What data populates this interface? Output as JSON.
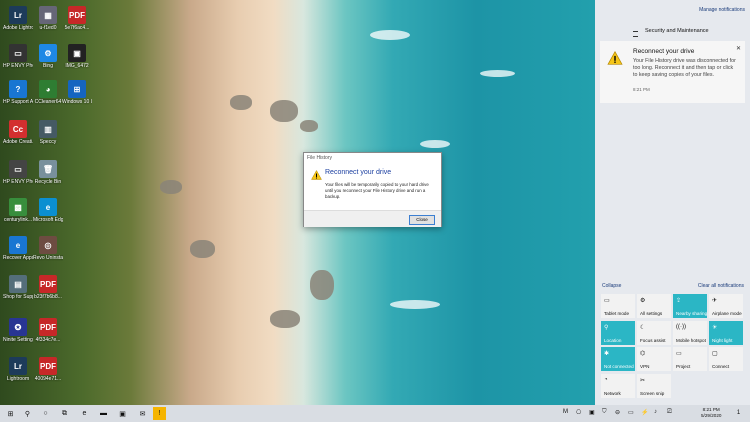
{
  "desktop_icons": [
    {
      "label": "Adobe Lightroom",
      "glyph": "Lr",
      "color": "#1d3b5a"
    },
    {
      "label": "u-f1ed0",
      "glyph": "▦",
      "color": "#667"
    },
    {
      "label": "5e7f6ac4...",
      "glyph": "PDF",
      "color": "#c62828"
    },
    {
      "label": "HP ENVY Photo 7...",
      "glyph": "▭",
      "color": "#333"
    },
    {
      "label": "Bing",
      "glyph": "⚙",
      "color": "#1e88e5"
    },
    {
      "label": "IMG_6472",
      "glyph": "▣",
      "color": "#222"
    },
    {
      "label": "HP Support Assistant",
      "glyph": "?",
      "color": "#1976d2"
    },
    {
      "label": "CCleaner64",
      "glyph": "◕",
      "color": "#2e7d32"
    },
    {
      "label": "Windows 10 Update A...",
      "glyph": "⊞",
      "color": "#1565c0"
    },
    {
      "label": "Adobe Creati...",
      "glyph": "Cc",
      "color": "#d32f2f"
    },
    {
      "label": "Speccy",
      "glyph": "▥",
      "color": "#455a64"
    },
    {
      "label": "HP ENVY Photo 71...",
      "glyph": "▭",
      "color": "#444"
    },
    {
      "label": "Recycle Bin",
      "glyph": "🗑",
      "color": "#78909c"
    },
    {
      "label": "centurylink...",
      "glyph": "▩",
      "color": "#388e3c"
    },
    {
      "label": "Microsoft Edge",
      "glyph": "e",
      "color": "#0b8fd1"
    },
    {
      "label": "Recover Apps",
      "glyph": "e",
      "color": "#1976d2"
    },
    {
      "label": "Revo Uninstaller",
      "glyph": "◎",
      "color": "#6d4c41"
    },
    {
      "label": "Shop for Supp...",
      "glyph": "▤",
      "color": "#546e7a"
    },
    {
      "label": "b23f7b6b8...",
      "glyph": "PDF",
      "color": "#c62828"
    },
    {
      "label": "Ninite Settings",
      "glyph": "✪",
      "color": "#283593"
    },
    {
      "label": "4f334c7e...",
      "glyph": "PDF",
      "color": "#c62828"
    },
    {
      "label": "Lightroom",
      "glyph": "Lr",
      "color": "#1d3b5a"
    },
    {
      "label": "40094e71...",
      "glyph": "PDF",
      "color": "#c62828"
    }
  ],
  "dialog": {
    "window_title": "File History",
    "heading": "Reconnect your drive",
    "message": "Your files will be temporarily copied to your hard drive until you reconnect your File History drive and run a backup.",
    "close_label": "Close"
  },
  "action_center": {
    "manage_label": "Manage notifications",
    "group_title": "Security and Maintenance",
    "notification": {
      "title": "Reconnect your drive",
      "body": "Your File History drive was disconnected for too long. Reconnect it and then tap or click to keep saving copies of your files.",
      "time": "8:21 PM",
      "close_glyph": "✕"
    },
    "collapse_label": "Collapse",
    "clear_label": "Clear all notifications",
    "tiles": [
      {
        "label": "Tablet mode",
        "icon": "▭",
        "on": false
      },
      {
        "label": "All settings",
        "icon": "⚙",
        "on": false
      },
      {
        "label": "Nearby sharing",
        "icon": "⇪",
        "on": true
      },
      {
        "label": "Airplane mode",
        "icon": "✈",
        "on": false
      },
      {
        "label": "Location",
        "icon": "⚲",
        "on": true
      },
      {
        "label": "Focus assist",
        "icon": "☾",
        "on": false
      },
      {
        "label": "Mobile hotspot",
        "icon": "((·))",
        "on": false
      },
      {
        "label": "Night light",
        "icon": "☀",
        "on": true
      },
      {
        "label": "Not connected",
        "icon": "✱",
        "on": true
      },
      {
        "label": "VPN",
        "icon": "⌬",
        "on": false
      },
      {
        "label": "Project",
        "icon": "▭",
        "on": false
      },
      {
        "label": "Connect",
        "icon": "▢",
        "on": false
      },
      {
        "label": "Network",
        "icon": "◔",
        "on": false
      },
      {
        "label": "Screen snip",
        "icon": "✂",
        "on": false
      }
    ]
  },
  "taskbar": {
    "items": [
      {
        "name": "start-button",
        "glyph": "⊞"
      },
      {
        "name": "search-button",
        "glyph": "⚲"
      },
      {
        "name": "cortana-button",
        "glyph": "○"
      },
      {
        "name": "task-view-button",
        "glyph": "⧉"
      },
      {
        "name": "edge-taskbar",
        "glyph": "e"
      },
      {
        "name": "file-explorer-taskbar",
        "glyph": "▬"
      },
      {
        "name": "store-taskbar",
        "glyph": "▣"
      },
      {
        "name": "mail-taskbar",
        "glyph": "✉"
      },
      {
        "name": "file-history-taskbar",
        "glyph": "!"
      }
    ],
    "tray_glyphs": [
      "M",
      "⎔",
      "▣",
      "⛉",
      "⊖",
      "▭",
      "⚡",
      "♪",
      "⎚"
    ],
    "time": "8:21 PM",
    "date": "5/29/2020",
    "notification_count": "1"
  }
}
